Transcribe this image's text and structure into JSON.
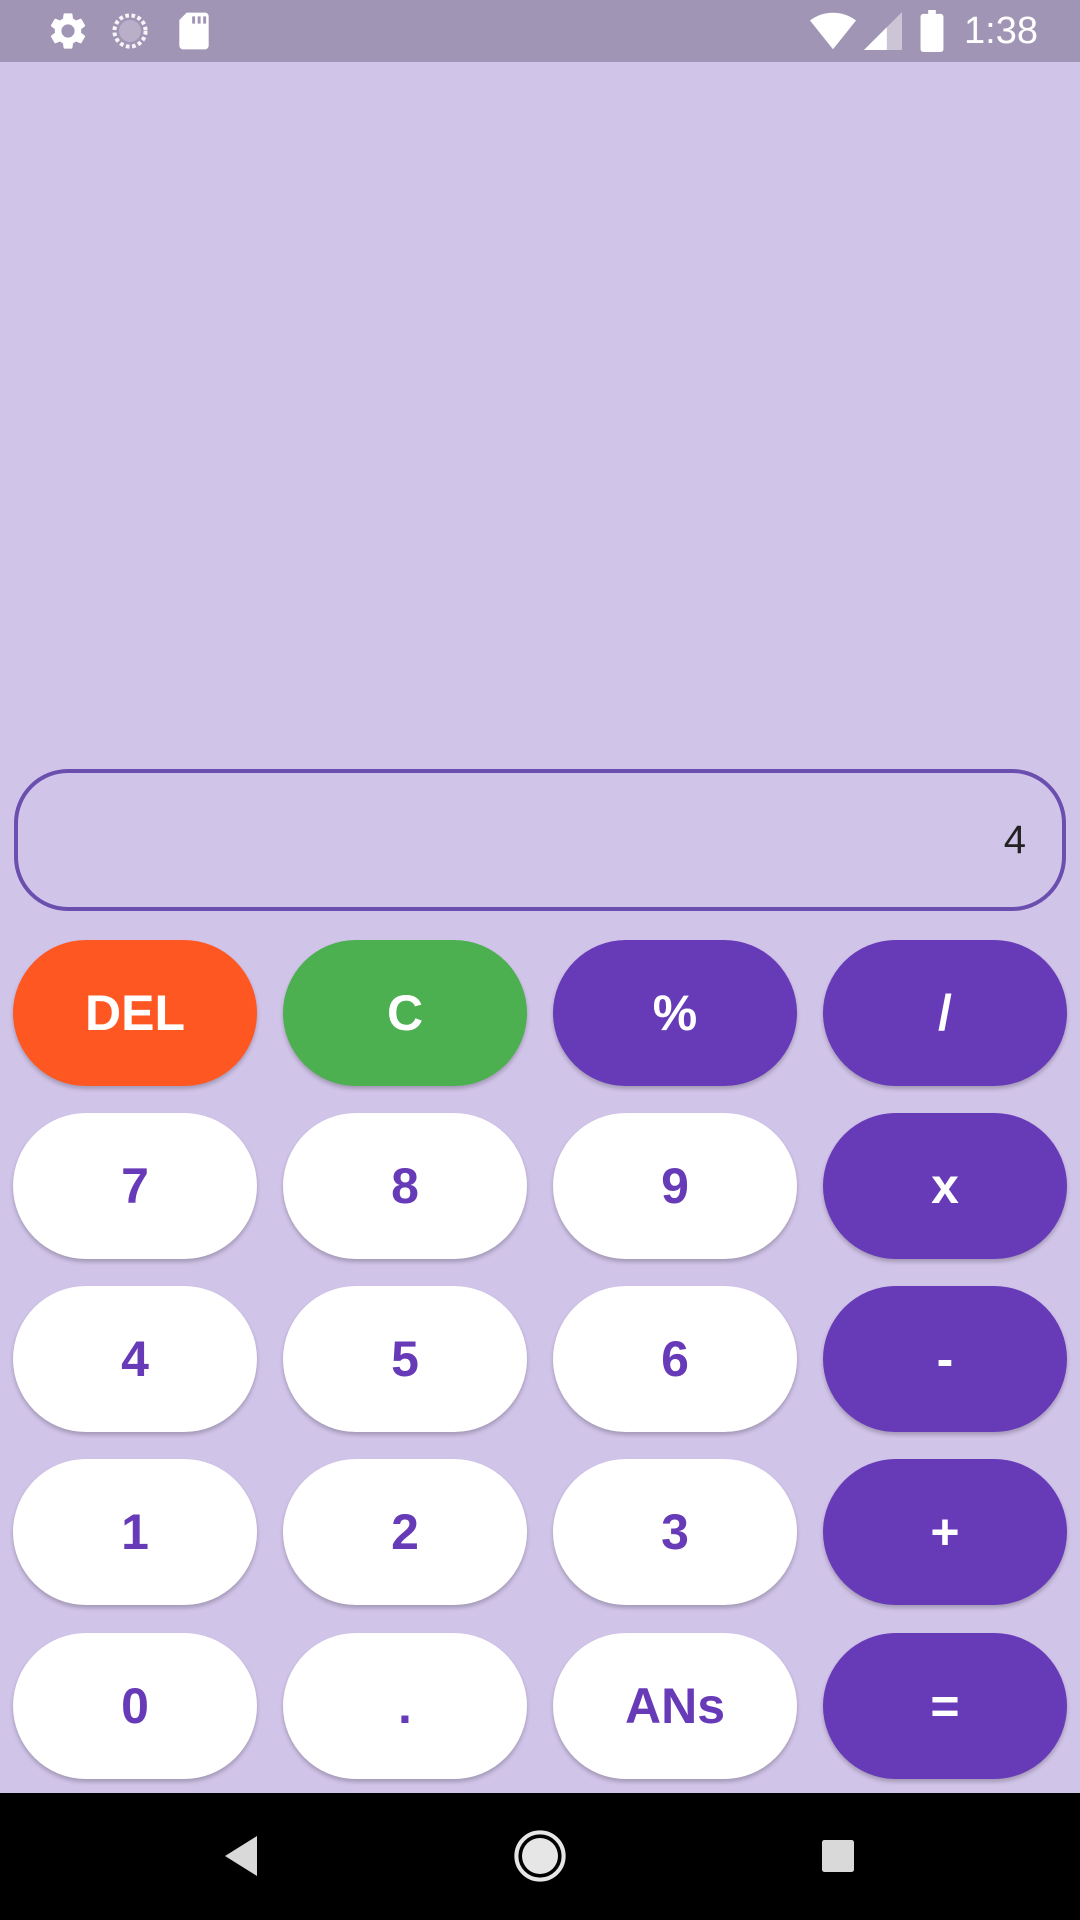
{
  "status_bar": {
    "time": "1:38",
    "left_icons": [
      "settings-icon",
      "sync-icon",
      "sd-card-icon"
    ],
    "right_icons": [
      "wifi-icon",
      "signal-icon",
      "battery-icon"
    ],
    "background": "#A195B5"
  },
  "display": {
    "expression": "",
    "result": "4"
  },
  "keypad": {
    "row1": [
      "DEL",
      "C",
      "%",
      "/"
    ],
    "row2": [
      "7",
      "8",
      "9",
      "x"
    ],
    "row3": [
      "4",
      "5",
      "6",
      "-"
    ],
    "row4": [
      "1",
      "2",
      "3",
      "+"
    ],
    "row5": [
      "0",
      ".",
      "ANs",
      "="
    ]
  },
  "nav_bar": {
    "icons": [
      "back-icon",
      "home-icon",
      "recents-icon"
    ]
  },
  "colors": {
    "background": "#D1C4E9",
    "primary": "#673AB7",
    "delete": "#FF5722",
    "clear": "#4CAF50",
    "number_key": "#FFFFFF",
    "border": "#6A4FAE"
  }
}
